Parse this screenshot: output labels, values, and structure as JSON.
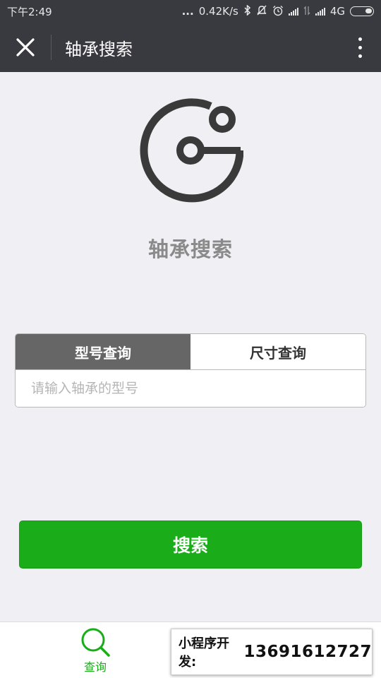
{
  "status_bar": {
    "time": "下午2:49",
    "dots": "...",
    "speed": "0.42K/s",
    "network": "4G",
    "icons": [
      "bluetooth-icon",
      "mute-icon",
      "alarm-icon",
      "signal-icon",
      "data-arrows-icon",
      "signal-icon",
      "battery-icon"
    ]
  },
  "nav": {
    "title": "轴承搜索",
    "close_icon": "close-icon",
    "more_icon": "more-vertical-icon"
  },
  "logo": {
    "icon": "app-logo-icon"
  },
  "app_name": "轴承搜索",
  "search": {
    "tabs": [
      {
        "label": "型号查询",
        "active": true
      },
      {
        "label": "尺寸查询",
        "active": false
      }
    ],
    "input_value": "",
    "placeholder": "请输入轴承的型号",
    "button_label": "搜索"
  },
  "tab_bar": {
    "items": [
      {
        "label": "查询",
        "icon": "search-icon",
        "active": true
      },
      {
        "label": "",
        "icon": "profile-icon",
        "active": false
      }
    ]
  },
  "promo": {
    "label": "小程序开发:",
    "phone": "13691612727"
  },
  "colors": {
    "bar_bg": "#393a3f",
    "page_bg": "#efeff4",
    "accent_green": "#1aad19",
    "tab_active_bg": "#666666"
  }
}
